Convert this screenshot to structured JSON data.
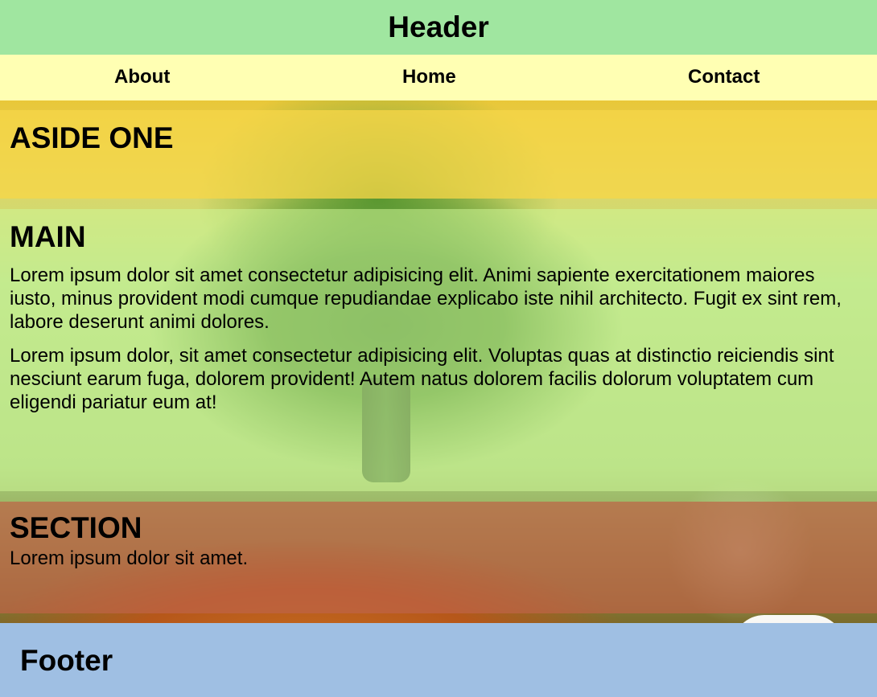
{
  "header": {
    "title": "Header"
  },
  "nav": {
    "items": [
      {
        "label": "About"
      },
      {
        "label": "Home"
      },
      {
        "label": "Contact"
      }
    ]
  },
  "aside": {
    "title": "ASIDE ONE"
  },
  "main": {
    "title": "MAIN",
    "paragraphs": [
      "Lorem ipsum dolor sit amet consectetur adipisicing elit. Animi sapiente exercitationem maiores iusto, minus provident modi cumque repudiandae explicabo iste nihil architecto. Fugit ex sint rem, labore deserunt animi dolores.",
      "Lorem ipsum dolor, sit amet consectetur adipisicing elit. Voluptas quas at distinctio reiciendis sint nesciunt earum fuga, dolorem provident! Autem natus dolorem facilis dolorum voluptatem cum eligendi pariatur eum at!"
    ]
  },
  "section": {
    "title": "SECTION",
    "text": "Lorem ipsum dolor sit amet."
  },
  "footer": {
    "title": "Footer"
  },
  "colors": {
    "header_bg": "#a0e6a0",
    "nav_bg": "#ffffb3",
    "footer_bg": "#9fbfe3"
  }
}
